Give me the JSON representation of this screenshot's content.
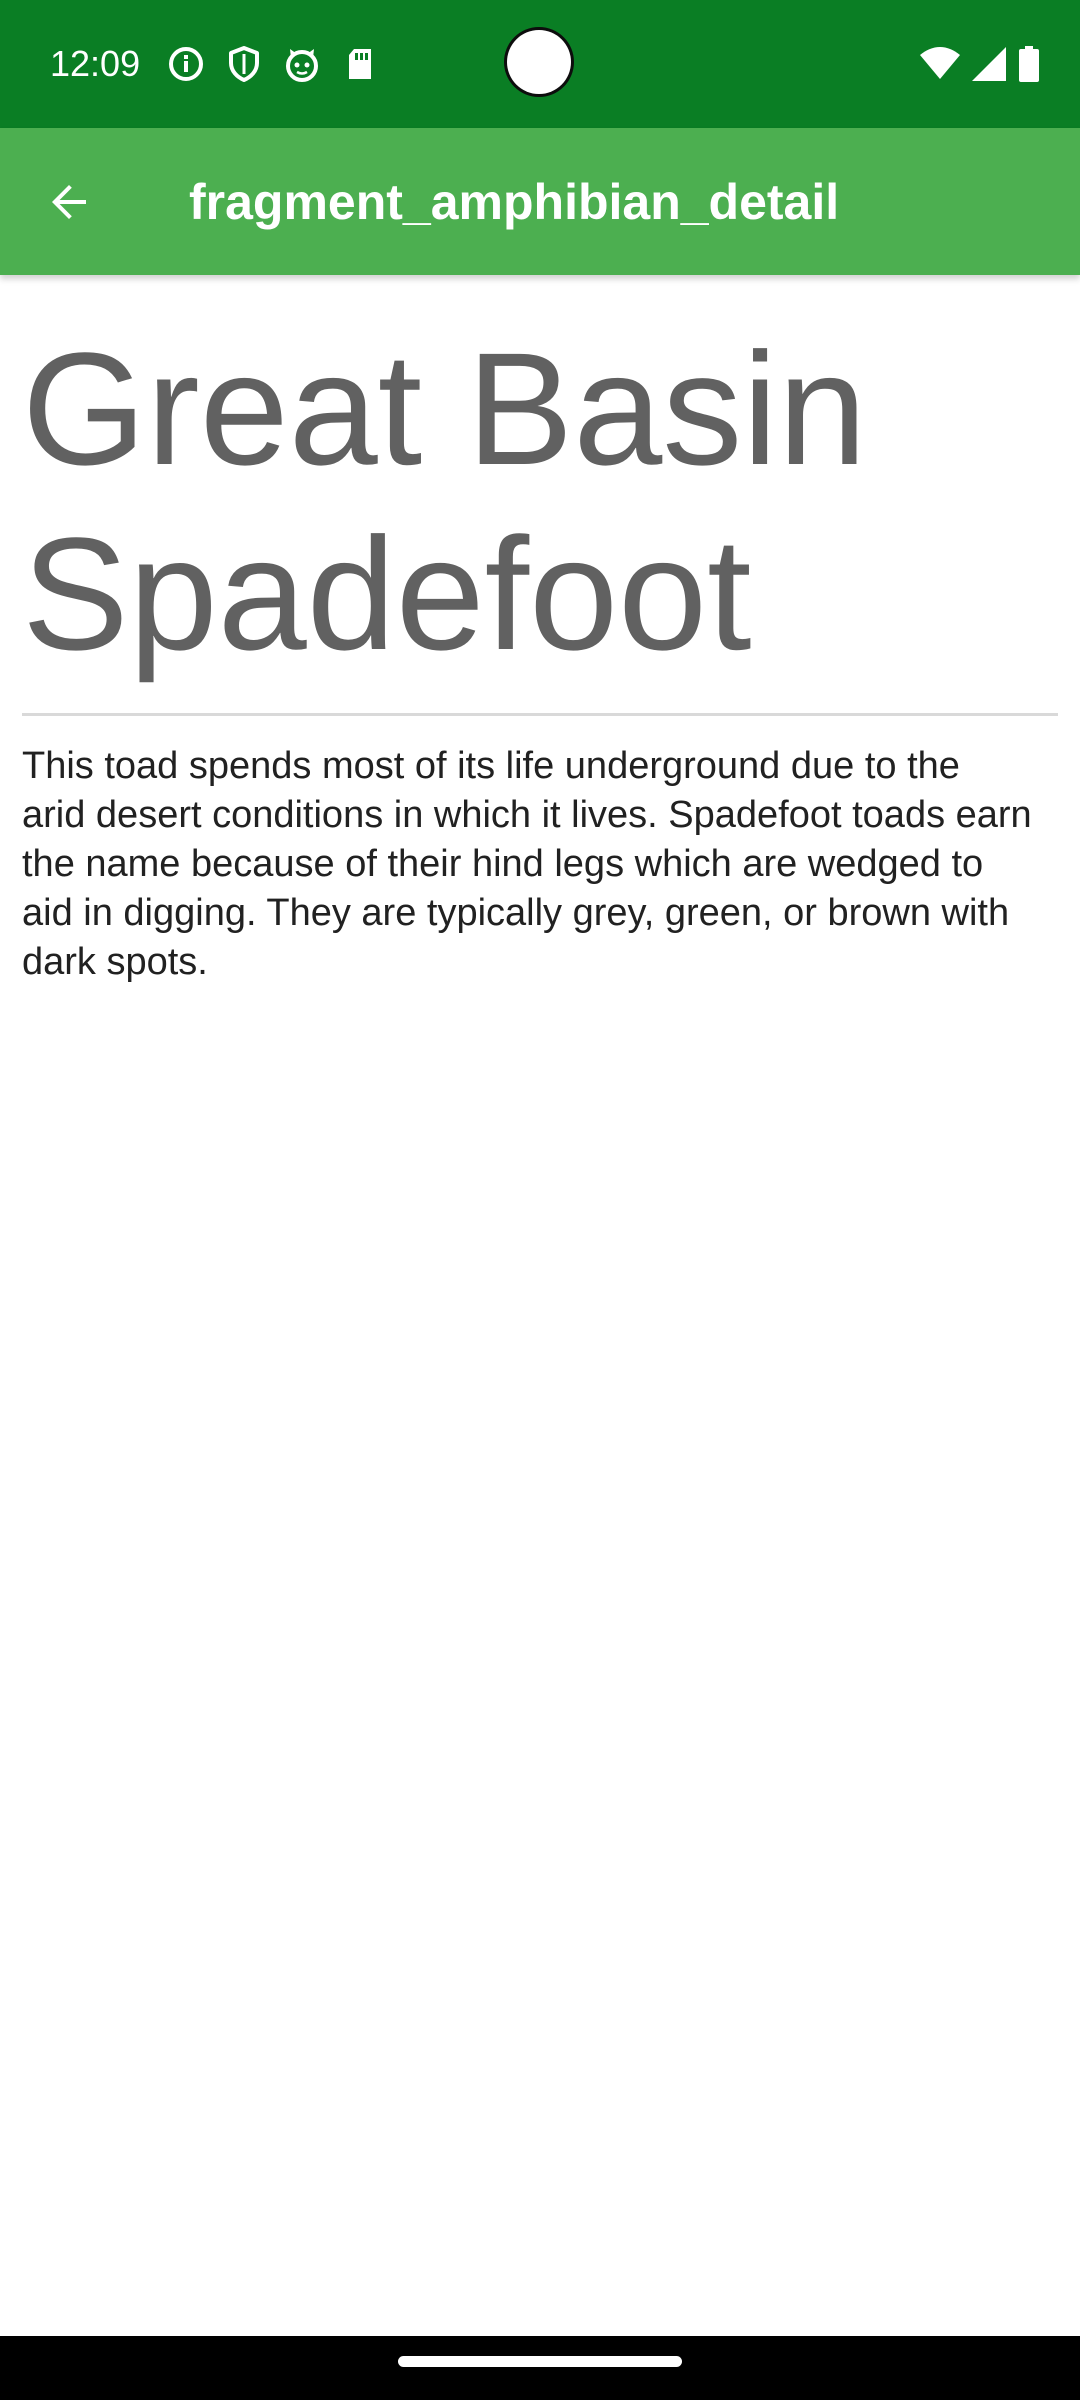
{
  "status_bar": {
    "time": "12:09",
    "color": "#0a7e24",
    "left_icons": [
      "info-icon",
      "shield-icon",
      "cat-icon",
      "sd-card-icon"
    ],
    "right_icons": [
      "wifi-icon",
      "cell-signal-icon",
      "battery-icon"
    ]
  },
  "app_bar": {
    "title": "fragment_amphibian_detail",
    "color": "#4caf50",
    "back_icon": "arrow-back-icon"
  },
  "detail": {
    "title": "Great Basin Spadefoot",
    "description": "This toad spends most of its life underground due to the arid desert conditions in which it lives. Spadefoot toads earn the name because of their hind legs which are wedged to aid in digging. They are typically grey, green, or brown with dark spots."
  },
  "nav_bar": {
    "home_indicator": "home-gesture-bar"
  }
}
